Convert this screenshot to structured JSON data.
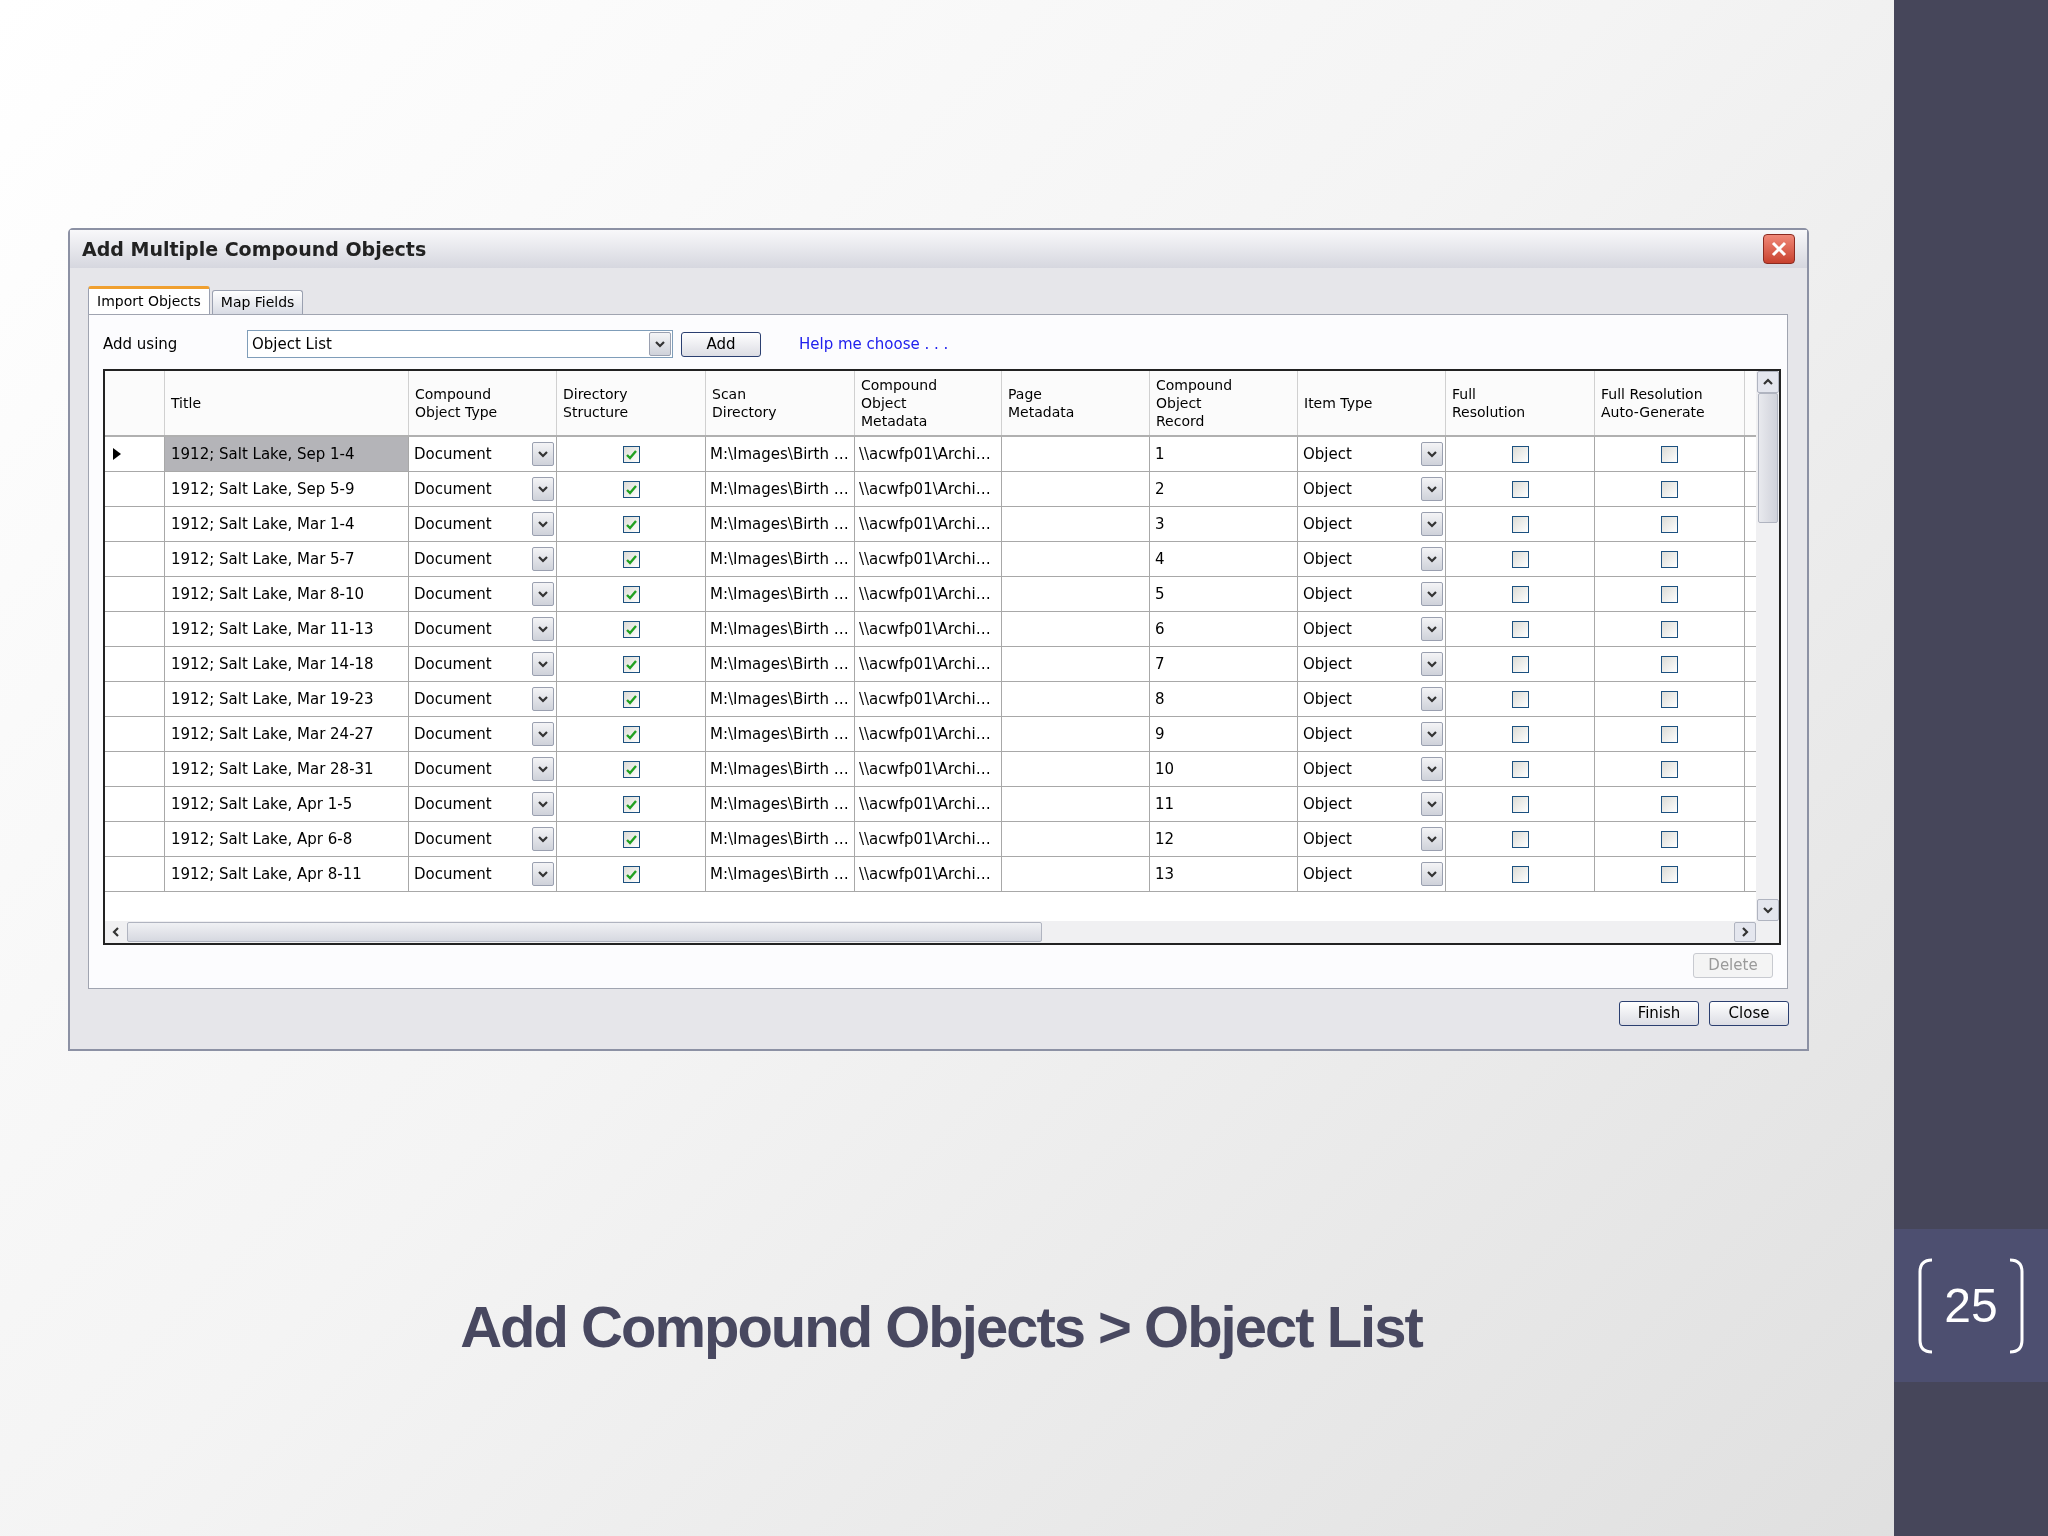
{
  "dialog": {
    "title": "Add Multiple Compound Objects",
    "tabs": [
      {
        "label": "Import Objects",
        "selected": true
      },
      {
        "label": "Map Fields",
        "selected": false
      }
    ],
    "add_using": {
      "label": "Add using",
      "value": "Object List",
      "button": "Add",
      "help_link": "Help me choose . . ."
    },
    "grid": {
      "columns": [
        "Title",
        "Compound\nObject Type",
        "Directory\nStructure",
        "Scan\nDirectory",
        "Compound\nObject\nMetadata",
        "Page\nMetadata",
        "Compound\nObject\nRecord",
        "Item Type",
        "Full\nResolution",
        "Full Resolution\nAuto-Generate"
      ],
      "rows": [
        {
          "selected": true,
          "title": "1912; Salt Lake, Sep 1-4",
          "object_type": "Document",
          "directory_structure": true,
          "scan_directory": "M:\\Images\\Birth …",
          "metadata": "\\\\acwfp01\\Archi…",
          "record": "1",
          "item_type": "Object",
          "full_resolution": false,
          "auto_generate": false
        },
        {
          "selected": false,
          "title": "1912; Salt Lake, Sep 5-9",
          "object_type": "Document",
          "directory_structure": true,
          "scan_directory": "M:\\Images\\Birth …",
          "metadata": "\\\\acwfp01\\Archi…",
          "record": "2",
          "item_type": "Object",
          "full_resolution": false,
          "auto_generate": false
        },
        {
          "selected": false,
          "title": "1912; Salt Lake, Mar 1-4",
          "object_type": "Document",
          "directory_structure": true,
          "scan_directory": "M:\\Images\\Birth …",
          "metadata": "\\\\acwfp01\\Archi…",
          "record": "3",
          "item_type": "Object",
          "full_resolution": false,
          "auto_generate": false
        },
        {
          "selected": false,
          "title": "1912; Salt Lake, Mar 5-7",
          "object_type": "Document",
          "directory_structure": true,
          "scan_directory": "M:\\Images\\Birth …",
          "metadata": "\\\\acwfp01\\Archi…",
          "record": "4",
          "item_type": "Object",
          "full_resolution": false,
          "auto_generate": false
        },
        {
          "selected": false,
          "title": "1912; Salt Lake, Mar 8-10",
          "object_type": "Document",
          "directory_structure": true,
          "scan_directory": "M:\\Images\\Birth …",
          "metadata": "\\\\acwfp01\\Archi…",
          "record": "5",
          "item_type": "Object",
          "full_resolution": false,
          "auto_generate": false
        },
        {
          "selected": false,
          "title": "1912; Salt Lake, Mar 11-13",
          "object_type": "Document",
          "directory_structure": true,
          "scan_directory": "M:\\Images\\Birth …",
          "metadata": "\\\\acwfp01\\Archi…",
          "record": "6",
          "item_type": "Object",
          "full_resolution": false,
          "auto_generate": false
        },
        {
          "selected": false,
          "title": "1912; Salt Lake, Mar 14-18",
          "object_type": "Document",
          "directory_structure": true,
          "scan_directory": "M:\\Images\\Birth …",
          "metadata": "\\\\acwfp01\\Archi…",
          "record": "7",
          "item_type": "Object",
          "full_resolution": false,
          "auto_generate": false
        },
        {
          "selected": false,
          "title": "1912; Salt Lake, Mar 19-23",
          "object_type": "Document",
          "directory_structure": true,
          "scan_directory": "M:\\Images\\Birth …",
          "metadata": "\\\\acwfp01\\Archi…",
          "record": "8",
          "item_type": "Object",
          "full_resolution": false,
          "auto_generate": false
        },
        {
          "selected": false,
          "title": "1912; Salt Lake, Mar 24-27",
          "object_type": "Document",
          "directory_structure": true,
          "scan_directory": "M:\\Images\\Birth …",
          "metadata": "\\\\acwfp01\\Archi…",
          "record": "9",
          "item_type": "Object",
          "full_resolution": false,
          "auto_generate": false
        },
        {
          "selected": false,
          "title": "1912; Salt Lake, Mar 28-31",
          "object_type": "Document",
          "directory_structure": true,
          "scan_directory": "M:\\Images\\Birth …",
          "metadata": "\\\\acwfp01\\Archi…",
          "record": "10",
          "item_type": "Object",
          "full_resolution": false,
          "auto_generate": false
        },
        {
          "selected": false,
          "title": "1912; Salt Lake, Apr 1-5",
          "object_type": "Document",
          "directory_structure": true,
          "scan_directory": "M:\\Images\\Birth …",
          "metadata": "\\\\acwfp01\\Archi…",
          "record": "11",
          "item_type": "Object",
          "full_resolution": false,
          "auto_generate": false
        },
        {
          "selected": false,
          "title": "1912; Salt Lake, Apr 6-8",
          "object_type": "Document",
          "directory_structure": true,
          "scan_directory": "M:\\Images\\Birth …",
          "metadata": "\\\\acwfp01\\Archi…",
          "record": "12",
          "item_type": "Object",
          "full_resolution": false,
          "auto_generate": false
        },
        {
          "selected": false,
          "title": "1912; Salt Lake, Apr 8-11",
          "object_type": "Document",
          "directory_structure": true,
          "scan_directory": "M:\\Images\\Birth …",
          "metadata": "\\\\acwfp01\\Archi…",
          "record": "13",
          "item_type": "Object",
          "full_resolution": false,
          "auto_generate": false
        }
      ]
    },
    "delete_button": {
      "label": "Delete",
      "disabled": true
    },
    "buttons": [
      "Finish",
      "Close"
    ]
  },
  "slide_title": "Add Compound Objects > Object List",
  "slide_number": "25"
}
